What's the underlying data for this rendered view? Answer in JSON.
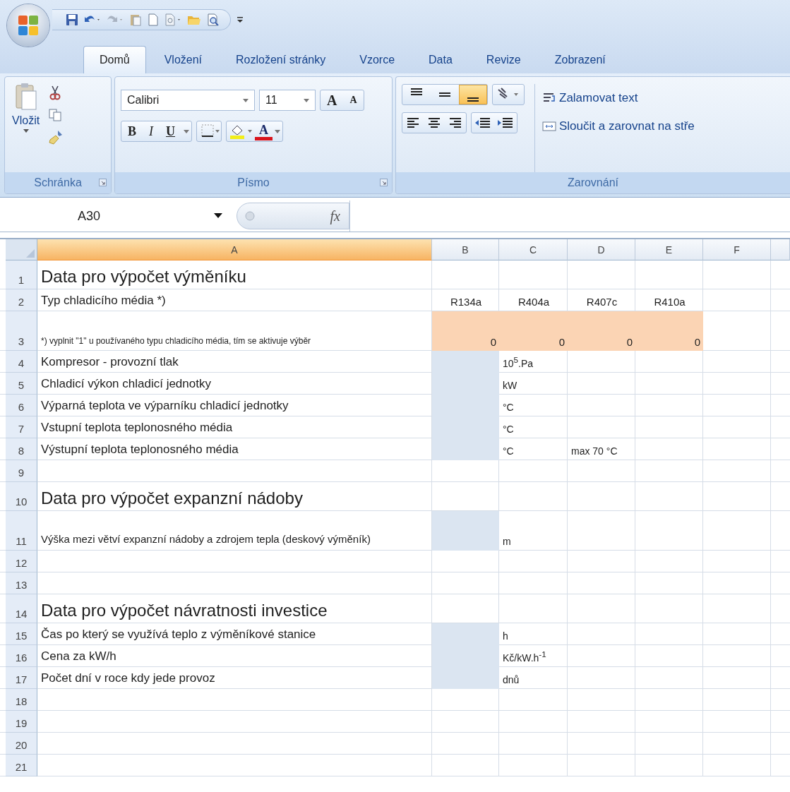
{
  "tabs": [
    {
      "label": "Domů",
      "selected": true
    },
    {
      "label": "Vložení",
      "selected": false
    },
    {
      "label": "Rozložení stránky",
      "selected": false
    },
    {
      "label": "Vzorce",
      "selected": false
    },
    {
      "label": "Data",
      "selected": false
    },
    {
      "label": "Revize",
      "selected": false
    },
    {
      "label": "Zobrazení",
      "selected": false
    }
  ],
  "ribbon": {
    "clipboard": {
      "paste_label": "Vložit",
      "group_label": "Schránka"
    },
    "font": {
      "name": "Calibri",
      "size": "11",
      "grow_glyph": "A",
      "shrink_glyph": "A",
      "bold": "B",
      "italic": "I",
      "underline": "U",
      "color_glyph": "A",
      "group_label": "Písmo"
    },
    "alignment": {
      "vertical_buttons": [
        {
          "selected": false
        },
        {
          "selected": false
        },
        {
          "selected": true
        }
      ],
      "wrap_label": "Zalamovat text",
      "merge_label": "Sloučit a zarovnat na stře",
      "group_label": "Zarovnání"
    }
  },
  "formula_bar": {
    "name_box": "A30",
    "fx": "fx"
  },
  "sheet": {
    "columns": [
      {
        "label": "A",
        "selected": true
      },
      {
        "label": "B",
        "selected": false
      },
      {
        "label": "C",
        "selected": false
      },
      {
        "label": "D",
        "selected": false
      },
      {
        "label": "E",
        "selected": false
      },
      {
        "label": "F",
        "selected": false
      }
    ],
    "rows": [
      {
        "number": "1",
        "kind": "title",
        "cells": [
          {
            "text": "Data pro výpočet výměníku"
          }
        ]
      },
      {
        "number": "2",
        "kind": "normal",
        "cells": [
          {
            "text": "Typ chladicího média *)"
          },
          {
            "text": "R134a",
            "kind": "centered"
          },
          {
            "text": "R404a",
            "kind": "centered"
          },
          {
            "text": "R407c",
            "kind": "centered"
          },
          {
            "text": "R410a",
            "kind": "centered"
          }
        ]
      },
      {
        "number": "3",
        "kind": "wrapped",
        "cells": [
          {
            "text": "*) vyplnit \"1\" u používaného typu chladicího média, tím se aktivuje výběr",
            "kind": "note"
          },
          {
            "text": "0",
            "kind": "number",
            "color": "#fbd4b4"
          },
          {
            "text": "0",
            "kind": "number",
            "color": "#fbd4b4"
          },
          {
            "text": "0",
            "kind": "number",
            "color": "#fbd4b4"
          },
          {
            "text": "0",
            "kind": "number",
            "color": "#fbd4b4"
          }
        ]
      },
      {
        "number": "4",
        "kind": "normal",
        "cells": [
          {
            "text": "Kompresor - provozní tlak"
          },
          {
            "color": "#dbe5f1"
          },
          {
            "text": "10$^{5}$.Pa",
            "kind": "unit"
          }
        ]
      },
      {
        "number": "5",
        "kind": "normal",
        "cells": [
          {
            "text": "Chladicí výkon chladicí jednotky"
          },
          {
            "color": "#dbe5f1"
          },
          {
            "text": "kW",
            "kind": "unit"
          }
        ]
      },
      {
        "number": "6",
        "kind": "normal",
        "cells": [
          {
            "text": "Výparná teplota ve výparníku chladicí jednotky"
          },
          {
            "color": "#dbe5f1"
          },
          {
            "text": "°C",
            "kind": "unit"
          }
        ]
      },
      {
        "number": "7",
        "kind": "normal",
        "cells": [
          {
            "text": "Vstupní teplota teplonosného média"
          },
          {
            "color": "#dbe5f1"
          },
          {
            "text": "°C",
            "kind": "unit"
          }
        ]
      },
      {
        "number": "8",
        "kind": "normal",
        "cells": [
          {
            "text": "Výstupní teplota teplonosného média"
          },
          {
            "color": "#dbe5f1"
          },
          {
            "text": "°C",
            "kind": "unit"
          },
          {
            "text": "max 70 °C",
            "kind": "unit"
          }
        ]
      },
      {
        "number": "9",
        "kind": "normal",
        "cells": []
      },
      {
        "number": "10",
        "kind": "title",
        "cells": [
          {
            "text": "Data pro výpočet expanzní nádoby"
          }
        ]
      },
      {
        "number": "11",
        "kind": "wrapped",
        "cells": [
          {
            "text": "Výška mezi větví expanzní nádoby a zdrojem tepla (deskový výměník)",
            "kind": "note-large"
          },
          {
            "color": "#dbe5f1"
          },
          {
            "text": "m",
            "kind": "unit"
          }
        ]
      },
      {
        "number": "12",
        "kind": "normal",
        "cells": []
      },
      {
        "number": "13",
        "kind": "normal",
        "cells": []
      },
      {
        "number": "14",
        "kind": "title",
        "cells": [
          {
            "text": "Data pro výpočet návratnosti investice"
          }
        ]
      },
      {
        "number": "15",
        "kind": "normal",
        "cells": [
          {
            "text": "Čas po který se využívá teplo z výměníkové stanice"
          },
          {
            "color": "#dbe5f1"
          },
          {
            "text": "h",
            "kind": "unit"
          }
        ]
      },
      {
        "number": "16",
        "kind": "normal",
        "cells": [
          {
            "text": "Cena za kW/h"
          },
          {
            "color": "#dbe5f1"
          },
          {
            "text": "Kč/kW.h$^{-1}$",
            "kind": "unit"
          }
        ]
      },
      {
        "number": "17",
        "kind": "normal",
        "cells": [
          {
            "text": "Počet dní v roce kdy jede provoz"
          },
          {
            "color": "#dbe5f1"
          },
          {
            "text": "dnů",
            "kind": "unit"
          }
        ]
      },
      {
        "number": "18",
        "kind": "normal",
        "cells": []
      },
      {
        "number": "19",
        "kind": "normal",
        "cells": []
      },
      {
        "number": "20",
        "kind": "normal",
        "cells": []
      },
      {
        "number": "21",
        "kind": "normal",
        "cells": []
      }
    ]
  }
}
